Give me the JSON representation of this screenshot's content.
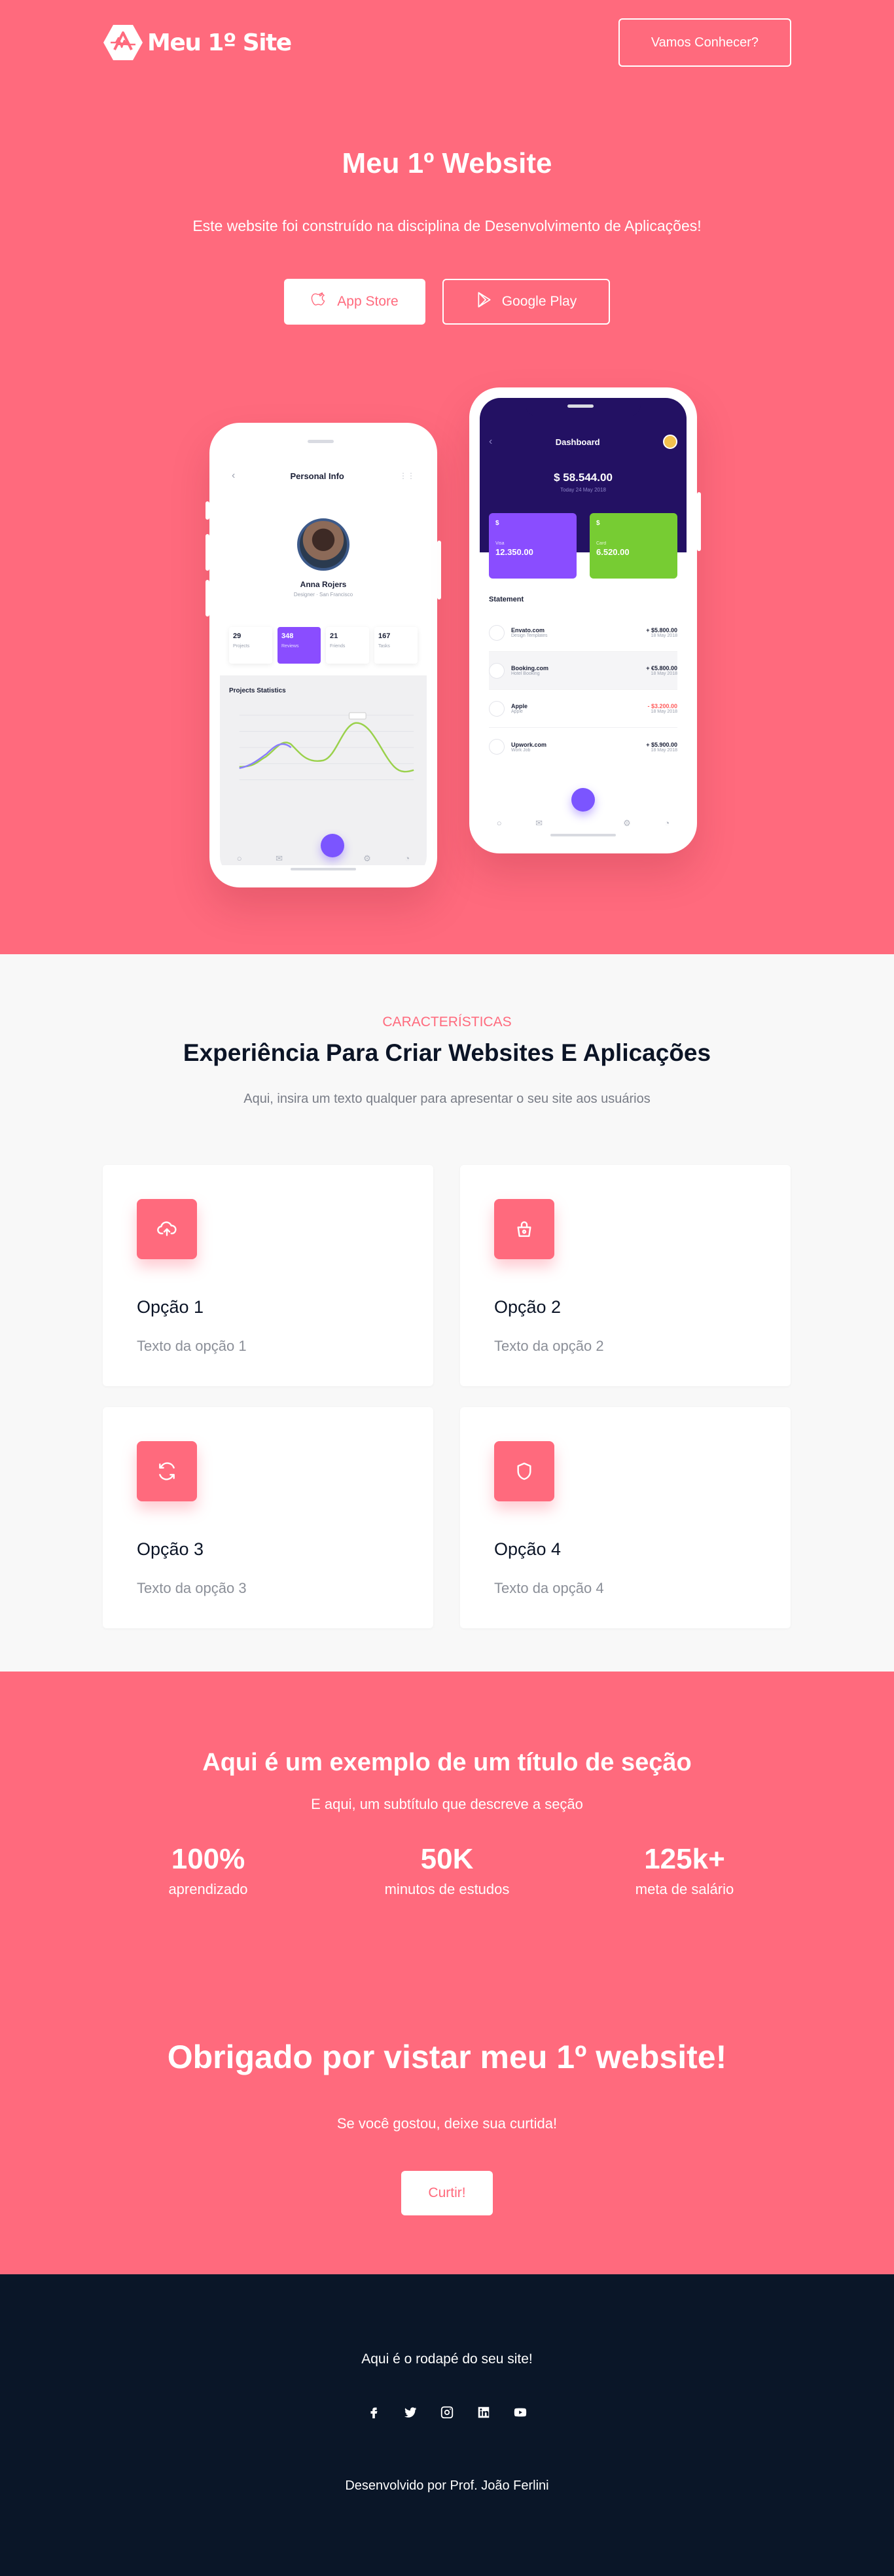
{
  "nav": {
    "logo_text": "Meu 1º Site",
    "cta_label": "Vamos Conhecer?"
  },
  "hero": {
    "title": "Meu 1º Website",
    "subtitle": "Este website foi construído na disciplina de Desenvolvimento de Aplicações!",
    "buttons": [
      {
        "label": "App Store",
        "icon": "apple-icon"
      },
      {
        "label": "Google Play",
        "icon": "play-icon"
      }
    ]
  },
  "phone_left": {
    "header": "Personal Info",
    "name": "Anna Rojers",
    "meta": "Designer · San Francisco",
    "stats": [
      {
        "value": "29",
        "label": "Projects"
      },
      {
        "value": "348",
        "label": "Reviews"
      },
      {
        "value": "21",
        "label": "Friends"
      },
      {
        "value": "167",
        "label": "Tasks"
      }
    ],
    "section": "Projects Statistics"
  },
  "phone_right": {
    "header": "Dashboard",
    "balance": "58.544.00",
    "balance_sub": "Today 24 May 2018",
    "cards": [
      {
        "label": "Visa",
        "value": "12.350.00",
        "color": "#8a4dff"
      },
      {
        "label": "Card",
        "value": "6.520.00",
        "color": "#77cc33"
      }
    ],
    "statement_title": "Statement",
    "statements": [
      {
        "name": "Envato.com",
        "desc": "Design Templates",
        "amount": "+ $5.800.00",
        "date": "18 May 2018",
        "color": "#1a1f36"
      },
      {
        "name": "Booking.com",
        "desc": "Hotel Booking",
        "amount": "+ €5.800.00",
        "date": "18 May 2018",
        "color": "#1a1f36"
      },
      {
        "name": "Apple",
        "desc": "Apple",
        "amount": "- $3.200.00",
        "date": "18 May 2018",
        "color": "#ff5a5a"
      },
      {
        "name": "Upwork.com",
        "desc": "Work Job",
        "amount": "+ $5.900.00",
        "date": "18 May 2018",
        "color": "#1a1f36"
      }
    ]
  },
  "features": {
    "eyebrow": "CARACTERÍSTICAS",
    "title": "Experiência Para Criar Websites E Aplicações",
    "subtitle": "Aqui, insira um texto qualquer para apresentar o seu site aos usuários",
    "cards": [
      {
        "title": "Opção 1",
        "text": "Texto da opção 1",
        "icon": "cloud-upload-icon"
      },
      {
        "title": "Opção 2",
        "text": "Texto da opção 2",
        "icon": "basket-icon"
      },
      {
        "title": "Opção 3",
        "text": "Texto da opção 3",
        "icon": "refresh-icon"
      },
      {
        "title": "Opção 4",
        "text": "Texto da opção 4",
        "icon": "shield-icon"
      }
    ]
  },
  "stats": {
    "title": "Aqui é um exemplo de um título de seção",
    "subtitle": "E aqui, um subtítulo que descreve a seção",
    "items": [
      {
        "value": "100%",
        "label": "aprendizado"
      },
      {
        "value": "50K",
        "label": "minutos de estudos"
      },
      {
        "value": "125k+",
        "label": "meta de salário"
      }
    ]
  },
  "thanks": {
    "title": "Obrigado por vistar meu 1º website!",
    "subtitle": "Se você gostou, deixe sua curtida!",
    "button": "Curtir!"
  },
  "footer": {
    "text": "Aqui é o rodapé do seu site!",
    "socials": [
      "facebook-icon",
      "twitter-icon",
      "instagram-icon",
      "linkedin-icon",
      "youtube-icon"
    ],
    "credit": "Desenvolvido por Prof. João Ferlini"
  },
  "colors": {
    "brand": "#ff6a7d",
    "dark": "#0a1628",
    "dashboard": "#231163"
  }
}
